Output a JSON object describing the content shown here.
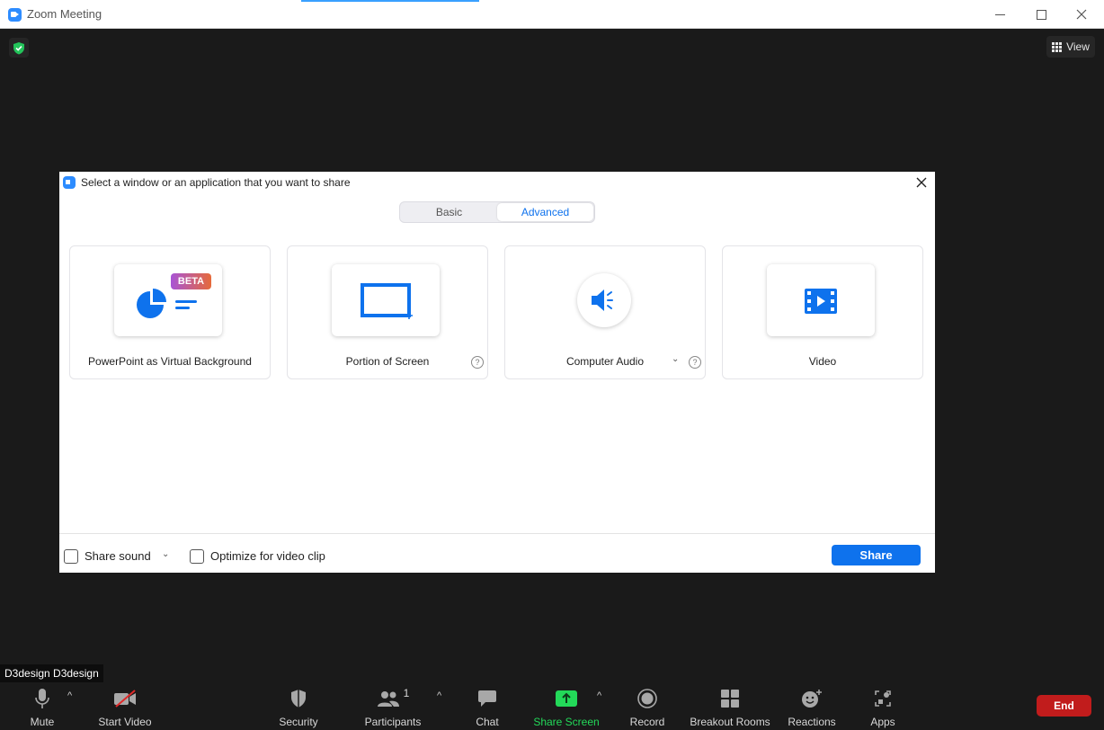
{
  "window": {
    "title": "Zoom Meeting"
  },
  "meeting": {
    "view_label": "View",
    "participant_name": "D3design D3design"
  },
  "dialog": {
    "title": "Select a window or an application that you want to share",
    "tabs": [
      {
        "label": "Basic",
        "selected": false
      },
      {
        "label": "Advanced",
        "selected": true
      }
    ],
    "options": [
      {
        "label": "PowerPoint as Virtual Background",
        "badge": "BETA",
        "icon": "powerpoint-pie-icon"
      },
      {
        "label": "Portion of Screen",
        "icon": "screen-portion-icon",
        "help": "?"
      },
      {
        "label": "Computer Audio",
        "icon": "speaker-icon",
        "help": "?"
      },
      {
        "label": "Video",
        "icon": "film-play-icon"
      }
    ],
    "footer": {
      "share_sound": "Share sound",
      "optimize_video": "Optimize for video clip",
      "share_button": "Share"
    }
  },
  "toolbar": {
    "mute": "Mute",
    "start_video": "Start Video",
    "security": "Security",
    "participants": "Participants",
    "participant_count": "1",
    "chat": "Chat",
    "share_screen": "Share Screen",
    "record": "Record",
    "breakout_rooms": "Breakout Rooms",
    "reactions": "Reactions",
    "apps": "Apps",
    "end": "End"
  },
  "colors": {
    "accent": "#0e72ed",
    "share_green": "#23d959",
    "end_red": "#c11c1c"
  }
}
